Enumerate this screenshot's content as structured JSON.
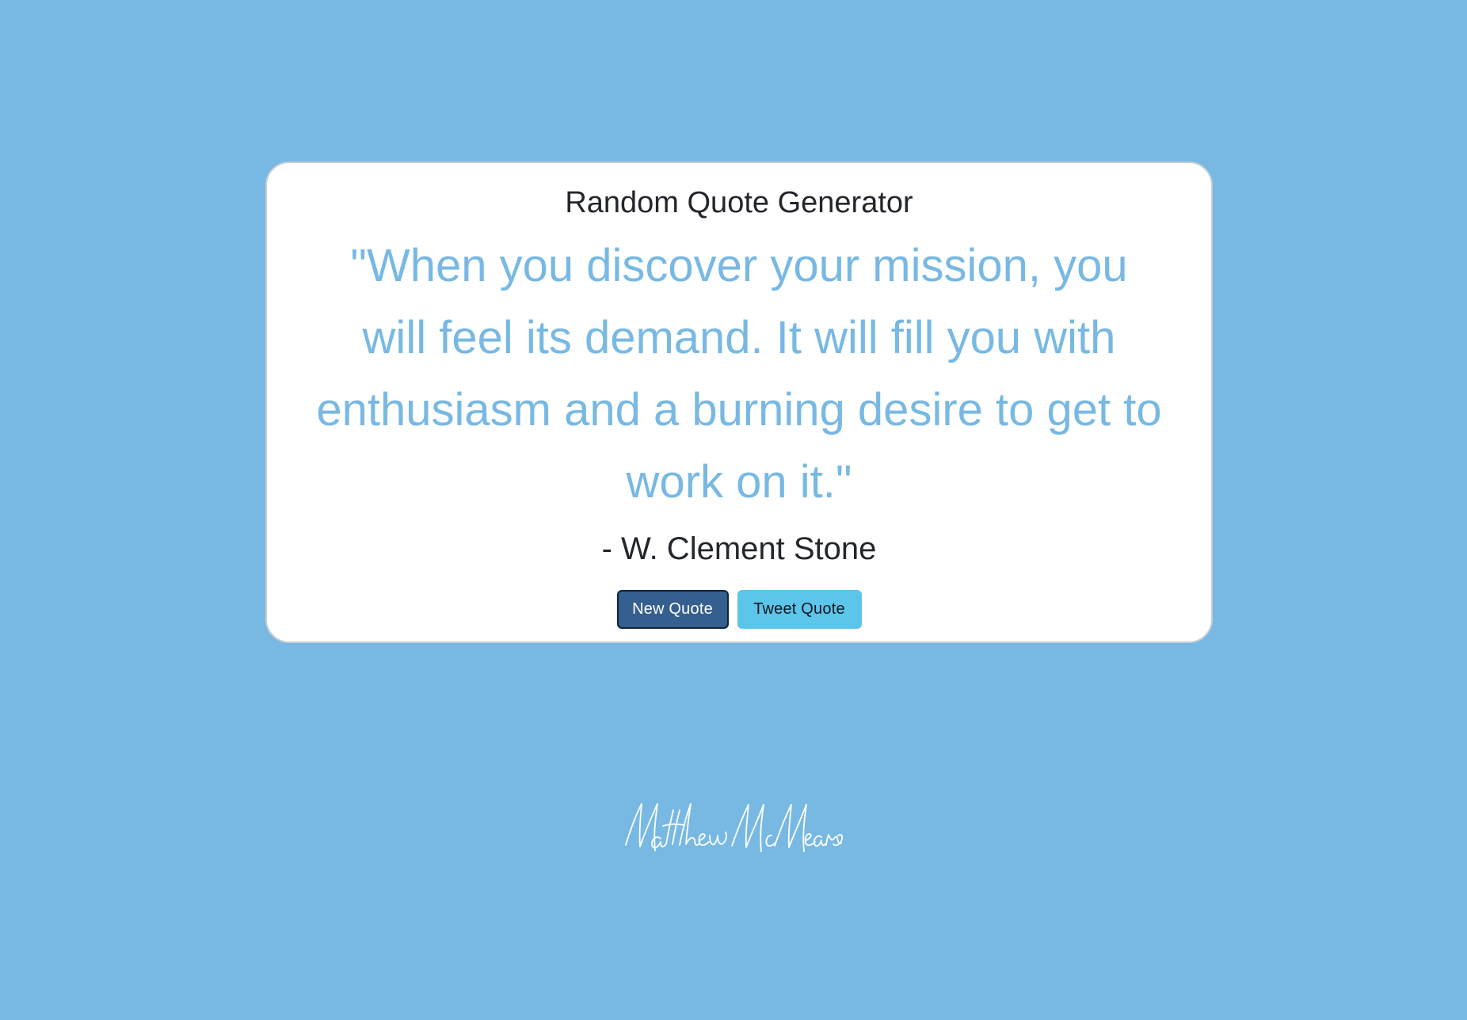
{
  "app": {
    "title": "Random Quote Generator"
  },
  "quote": {
    "text": "\"When you discover your mission, you will feel its demand. It will fill you with enthusiasm and a burning desire to get to work on it.\"",
    "author": "- W. Clement Stone"
  },
  "buttons": {
    "new_quote_label": "New Quote",
    "tweet_quote_label": "Tweet Quote"
  },
  "footer": {
    "signature_text": "Matthew McMeans"
  },
  "colors": {
    "background": "#78b9e4",
    "card": "#ffffff",
    "quote_text": "#78b9e4",
    "new_quote_button": "#345f8e",
    "tweet_button": "#5bc5ea"
  }
}
